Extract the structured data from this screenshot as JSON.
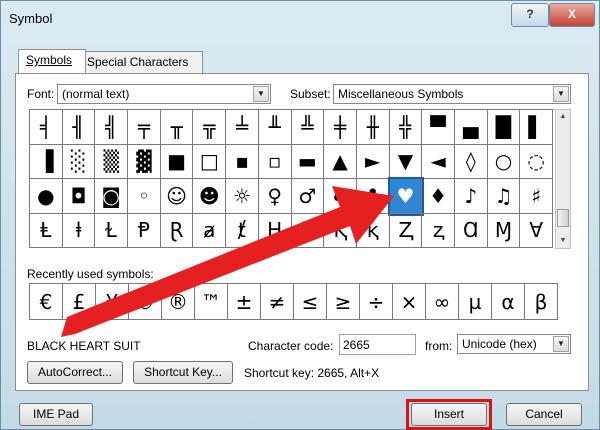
{
  "window": {
    "title": "Symbol",
    "help_label": "?",
    "close_label": "X"
  },
  "tabs": [
    {
      "label": "Symbols"
    },
    {
      "label": "Special Characters"
    }
  ],
  "font": {
    "label": "Font:",
    "value": "(normal text)"
  },
  "subset": {
    "label": "Subset:",
    "value": "Miscellaneous Symbols"
  },
  "symbol_grid": [
    [
      "╡",
      "╢",
      "╣",
      "╤",
      "╥",
      "╦",
      "╧",
      "╨",
      "╩",
      "╪",
      "╫",
      "╬",
      "▀",
      "▄",
      "█",
      "▌"
    ],
    [
      "▐",
      "░",
      "▒",
      "▓",
      "■",
      "□",
      "▪",
      "▫",
      "▬",
      "▲",
      "►",
      "▼",
      "◄",
      "◊",
      "○",
      "◌"
    ],
    [
      "●",
      "◘",
      "◙",
      "◦",
      "☺",
      "☻",
      "☼",
      "♀",
      "♂",
      "♠",
      "♣",
      "♥",
      "♦",
      "♪",
      "♫",
      "♯"
    ],
    [
      "Ⱡ",
      "ⱡ",
      "Ɫ",
      "Ᵽ",
      "Ɽ",
      "ⱥ",
      "ⱦ",
      "Ⱨ",
      "ⱨ",
      "Ⱪ",
      "ⱪ",
      "Ⱬ",
      "ⱬ",
      "Ɑ",
      "Ɱ",
      "Ɐ"
    ]
  ],
  "selected_symbol": {
    "row": 2,
    "col": 11
  },
  "recent": {
    "label": "Recently used symbols:",
    "symbols": [
      "€",
      "£",
      "¥",
      "©",
      "®",
      "™",
      "±",
      "≠",
      "≤",
      "≥",
      "÷",
      "×",
      "∞",
      "µ",
      "α",
      "β"
    ]
  },
  "char_name": "BLACK HEART SUIT",
  "char_code": {
    "label": "Character code:",
    "value": "2665"
  },
  "from": {
    "label": "from:",
    "value": "Unicode (hex)"
  },
  "buttons": {
    "autocorrect": "AutoCorrect...",
    "shortcut_key": "Shortcut Key...",
    "ime_pad": "IME Pad",
    "insert": "Insert",
    "cancel": "Cancel"
  },
  "shortcut_info": "Shortcut key: 2665, Alt+X",
  "colors": {
    "highlight": "#e01111",
    "selection": "#2f86d5"
  }
}
